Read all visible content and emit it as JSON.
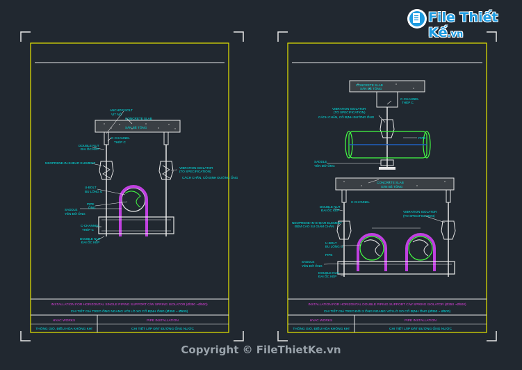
{
  "watermark": {
    "logo_text": "File Thiết Kế",
    "logo_suffix": ".vn",
    "copyright": "Copyright © FileThietKe.vn"
  },
  "left_sheet": {
    "title_line1": "INSTALLATION FOR HORIZONTAL SINGLE PIPING SUPPORT C/W SPRING ISOLATOR (Ø350 ~Ø500)",
    "title_line2": "CHI TIẾT GIÁ TREO ỐNG NGANG VỚI LÒ XO CỐ ĐỊNH ỐNG (Ø350 ~ Ø500)",
    "cell_left_1": "HVAC WORKS",
    "cell_left_2": "THÔNG GIÓ, ĐIỀU HÒA KHÔNG KHÍ",
    "cell_right_1": "PIPE INSTALLATION",
    "cell_right_2": "CHI TIẾT LẮP ĐẶT ĐƯỜNG ỐNG NƯỚC",
    "labels": {
      "anchor_bolt": "ANCHOR BOLT",
      "anchor_bolt_vi": "VÍT NỞ",
      "slab": "CONCRETE SLAB",
      "slab_vi": "SÀN BÊ TÔNG",
      "c_channel": "C-CHANNEL",
      "c_channel_vi": "THÉP C",
      "double_nut": "DOUBLE NUT",
      "double_nut_vi": "ĐAI ỐC KÉP",
      "neoprene": "NEOPRENE-IN-SHEAR ELEMENT",
      "vib_iso": "VIBRATION ISOLATOR",
      "vib_spec": "(TO SPECIFICATION)",
      "vib_vi": "CÁCH CHẤN, CỐ ĐỊNH ĐƯỜNG ỐNG",
      "u_bolt": "U-BOLT",
      "u_bolt_vi": "BU LÔNG U",
      "pipe": "PIPE",
      "pipe_vi": "ỐNG",
      "saddle": "SADDLE",
      "saddle_vi": "YÊN ĐỠ ỐNG",
      "c_channel2": "C-CHANNEL",
      "c_channel2_vi": "THÉP C",
      "double_nut2": "DOUBLE NUT",
      "double_nut2_vi": "ĐAI ỐC KÉP"
    }
  },
  "right_sheet": {
    "title_line1": "INSTALLATION FOR HORIZONTAL DOUBLE PIPING SUPPORT C/W SPRING ISOLATOR (Ø350 ~Ø500)",
    "title_line2": "CHI TIẾT GIÁ TREO ĐÔI 2 ỐNG NGANG VỚI LÒ XO CỐ ĐỊNH ỐNG (Ø350 ~ Ø500)",
    "cell_left_1": "HVAC WORKS",
    "cell_left_2": "THÔNG GIÓ, ĐIỀU HÒA KHÔNG KHÍ",
    "cell_right_1": "PIPE INSTALLATION",
    "cell_right_2": "CHI TIẾT LẮP ĐẶT ĐƯỜNG ỐNG NƯỚC",
    "labels": {
      "slab": "CONCRETE SLAB",
      "slab_vi": "SÀN BÊ TÔNG",
      "c_channel": "C-CHANNEL",
      "c_channel_vi": "THÉP C",
      "vib_iso": "VIBRATION ISOLATOR",
      "vib_spec": "(TO SPECIFICATION)",
      "vib_vi": "CÁCH CHẤN, CỐ ĐỊNH ĐƯỜNG ỐNG",
      "pipe": "PIPE",
      "saddle": "SADDLE",
      "saddle_vi": "YÊN ĐỠ ỐNG",
      "slab2": "CONCRETE SLAB",
      "slab2_vi": "SÀN BÊ TÔNG",
      "c_channel2": "C-CHANNEL",
      "double_nut": "DOUBLE NUT",
      "double_nut_vi": "ĐAI ỐC KÉP",
      "neoprene": "NEOPRENE-IN-SHEAR ELEMENT",
      "neoprene_vi": "ĐỆM CAO SU GIẢM CHẤN",
      "vib_iso2": "VIBRATION ISOLATOR",
      "vib_spec2": "(TO SPECIFICATION)",
      "u_bolt": "U-BOLT",
      "u_bolt_vi": "BU LÔNG U",
      "pipe2": "PIPE",
      "saddle2": "SADDLE",
      "saddle2_vi": "YÊN ĐỠ ỐNG",
      "double_nut2": "DOUBLE NUT",
      "double_nut2_vi": "ĐAI ỐC KÉP"
    }
  },
  "colors": {
    "frame": "#e6e600",
    "line": "#e8e8e8",
    "label": "#00e5e5",
    "title": "#e040e0",
    "u_bolt": "#c040e0",
    "pipe_green": "#44ff44",
    "pipe_blue": "#2060c0"
  }
}
